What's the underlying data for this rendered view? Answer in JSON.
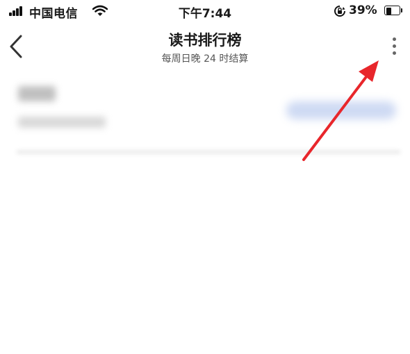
{
  "status_bar": {
    "carrier": "中国电信",
    "time": "下午7:44",
    "battery_percent": "39%",
    "battery_level": 0.39,
    "icons": [
      "signal-icon",
      "wifi-icon",
      "rotation-lock-icon",
      "battery-icon"
    ]
  },
  "nav": {
    "title": "读书排行榜",
    "subtitle": "每周日晚 24 时结算",
    "back_icon": "chevron-left-icon",
    "more_icon": "more-vertical-icon"
  },
  "annotation": {
    "color": "#e8262b",
    "target": "more-button"
  }
}
